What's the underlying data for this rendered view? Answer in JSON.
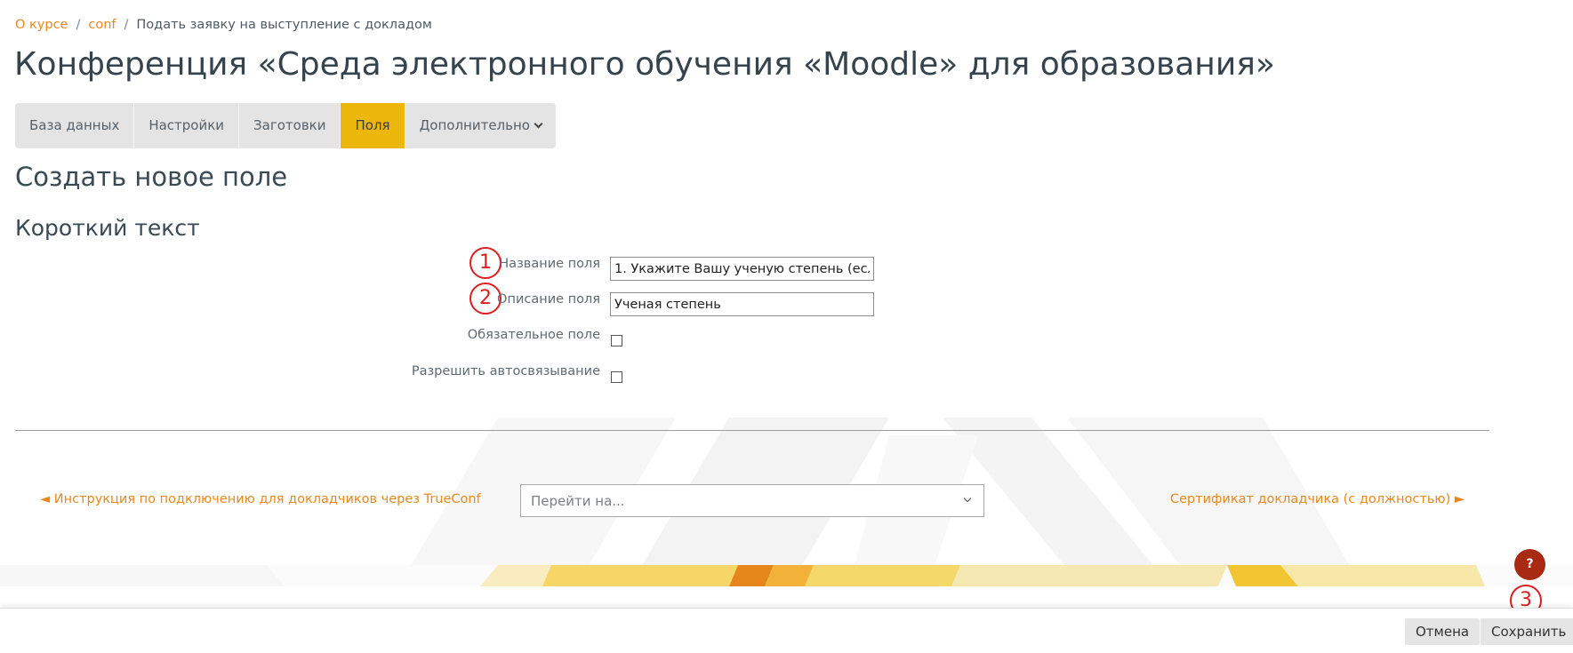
{
  "breadcrumb": {
    "items": [
      "О курсе",
      "conf",
      "Подать заявку на выступление с докладом"
    ],
    "separator": "/"
  },
  "page": {
    "title": "Конференция «Среда электронного обучения «Moodle» для образования»",
    "section_title": "Создать новое поле",
    "field_type": "Короткий текст"
  },
  "tabs": [
    {
      "label": "База данных",
      "active": false
    },
    {
      "label": "Настройки",
      "active": false
    },
    {
      "label": "Заготовки",
      "active": false
    },
    {
      "label": "Поля",
      "active": true
    },
    {
      "label": "Дополнительно",
      "active": false,
      "icon": "chevron-down-icon"
    }
  ],
  "form": {
    "field_name": {
      "label": "Название поля",
      "value": "1. Укажите Вашу ученую степень (если ес"
    },
    "field_description": {
      "label": "Описание поля",
      "value": "Ученая степень"
    },
    "required": {
      "label": "Обязательное поле",
      "checked": false
    },
    "autolink": {
      "label": "Разрешить автосвязывание",
      "checked": false
    }
  },
  "annotations": [
    "1",
    "2",
    "3"
  ],
  "activity_nav": {
    "prev": "◄ Инструкция по подключению для докладчиков через TrueConf",
    "jump_placeholder": "Перейти на...",
    "next": "Сертификат докладчика (с должностью) ►"
  },
  "footer": {
    "cancel_label": "Отмена",
    "save_label": "Сохранить"
  },
  "help_button": {
    "label": "?"
  },
  "colors": {
    "accent": "#e8891d",
    "active_tab": "#ecb60a",
    "annotation": "#dc1e1e",
    "help": "#a82a12"
  }
}
